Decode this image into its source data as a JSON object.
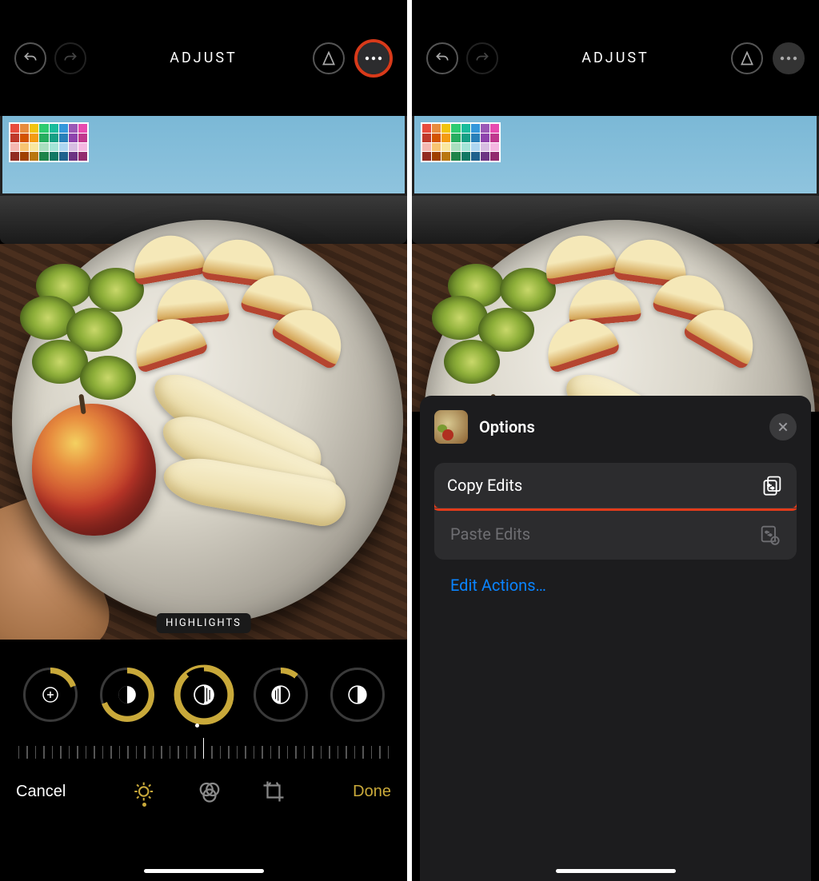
{
  "topbar": {
    "title": "ADJUST"
  },
  "editor": {
    "active_adjust_label": "HIGHLIGHTS",
    "adjustments": [
      {
        "name": "exposure",
        "progress_deg": 70
      },
      {
        "name": "brilliance",
        "progress_deg": 250
      },
      {
        "name": "highlights",
        "progress_deg": 320
      },
      {
        "name": "shadows",
        "progress_deg": 40
      },
      {
        "name": "contrast",
        "progress_deg": 0
      }
    ]
  },
  "bottom": {
    "cancel": "Cancel",
    "done": "Done"
  },
  "options_sheet": {
    "title": "Options",
    "copy_edits": "Copy Edits",
    "paste_edits": "Paste Edits",
    "edit_actions": "Edit Actions…"
  },
  "colors": {
    "accent": "#c9a93a",
    "done": "#c9a93a",
    "highlight": "#e23b1a",
    "link": "#0a84ff"
  }
}
